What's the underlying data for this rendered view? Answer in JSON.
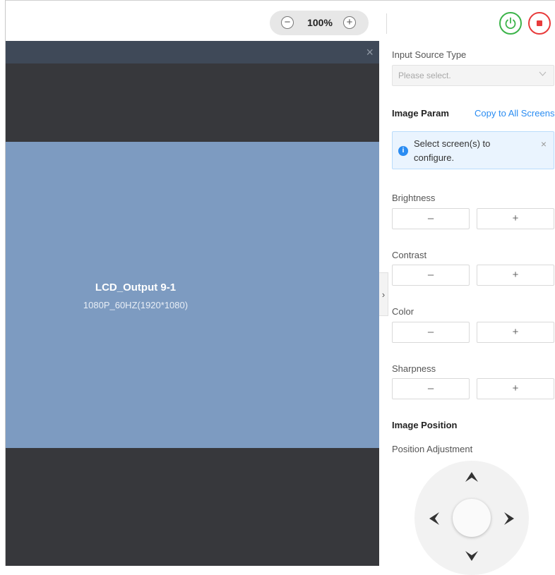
{
  "toolbar": {
    "zoom_value": "100%",
    "zoom_out_glyph": "−",
    "zoom_in_glyph": "+",
    "power_color": "#3cb44a",
    "stop_color": "#e83b3b"
  },
  "canvas": {
    "close_glyph": "×",
    "screen": {
      "name": "LCD_Output 9-1",
      "resolution": "1080P_60HZ(1920*1080)",
      "color": "#7d9bc1"
    },
    "collapse_glyph": "›"
  },
  "panel": {
    "input_source_label": "Input Source Type",
    "input_source_placeholder": "Please select.",
    "image_param_title": "Image Param",
    "copy_link": "Copy to All Screens",
    "info_text": "Select screen(s) to configure.",
    "info_close": "×",
    "params": [
      {
        "label": "Brightness",
        "minus": "–",
        "plus": "+"
      },
      {
        "label": "Contrast",
        "minus": "–",
        "plus": "+"
      },
      {
        "label": "Color",
        "minus": "–",
        "plus": "+"
      },
      {
        "label": "Sharpness",
        "minus": "–",
        "plus": "+"
      }
    ],
    "image_position_title": "Image Position",
    "position_adjustment_label": "Position Adjustment",
    "accent_color": "#2a8cf2"
  }
}
